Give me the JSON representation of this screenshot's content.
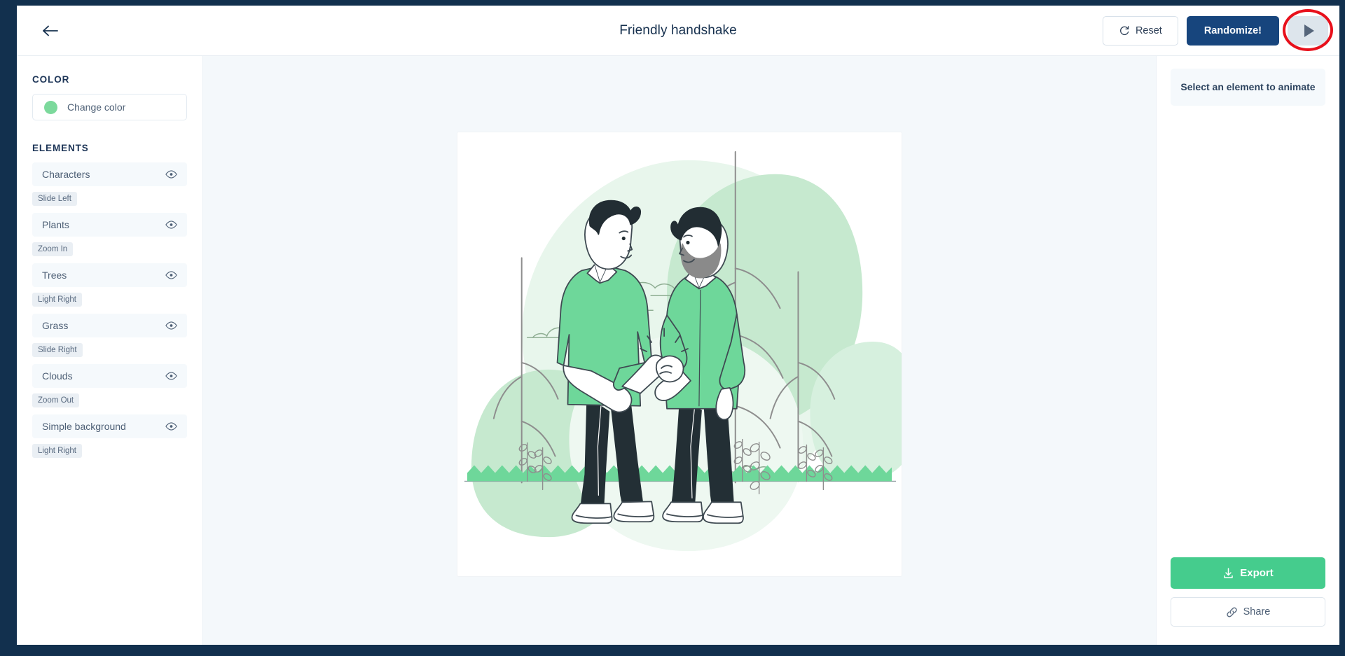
{
  "window": {
    "frame_color": "#12304e"
  },
  "header": {
    "back_icon": "arrow-left-icon",
    "title": "Friendly handshake",
    "reset_label": "Reset",
    "reset_icon": "refresh-icon",
    "randomize_label": "Randomize!",
    "play_icon": "play-icon",
    "annotation": "red-circle-highlight",
    "randomize_bg": "#17457d",
    "annotation_color": "#e8101b"
  },
  "sidebar": {
    "color_section_label": "COLOR",
    "color_button_label": "Change color",
    "color_swatch_hex": "#7cd99c",
    "elements_section_label": "ELEMENTS",
    "elements": [
      {
        "name": "Characters",
        "animation": "Slide Left",
        "visible_icon": "eye-icon"
      },
      {
        "name": "Plants",
        "animation": "Zoom In",
        "visible_icon": "eye-icon"
      },
      {
        "name": "Trees",
        "animation": "Light Right",
        "visible_icon": "eye-icon"
      },
      {
        "name": "Grass",
        "animation": "Slide Right",
        "visible_icon": "eye-icon"
      },
      {
        "name": "Clouds",
        "animation": "Zoom Out",
        "visible_icon": "eye-icon"
      },
      {
        "name": "Simple background",
        "animation": "Light Right",
        "visible_icon": "eye-icon"
      }
    ]
  },
  "right_panel": {
    "hint": "Select an element to animate",
    "export_label": "Export",
    "export_icon": "download-icon",
    "export_bg": "#45cc8d",
    "share_label": "Share",
    "share_icon": "link-icon"
  },
  "illustration": {
    "description": "Two men shaking hands outdoors with trees, plants, grass and clouds",
    "palette": {
      "shirt_green": "#6ed79a",
      "blob_light": "#e4f4e8",
      "blob_mid": "#bfe9ca",
      "grass_green": "#6ed79a",
      "trousers_dark": "#232f35",
      "hair_dark": "#222d33",
      "outline": "#3f4a52",
      "tree_trunk": "#8e8e8e"
    }
  }
}
